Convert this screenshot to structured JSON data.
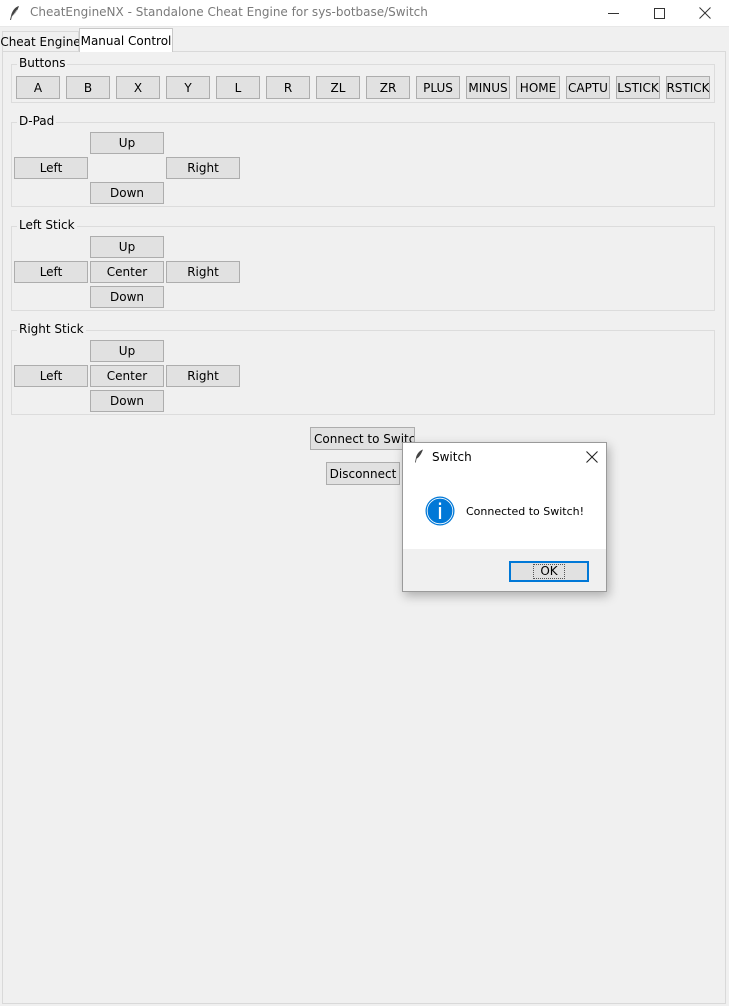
{
  "window": {
    "title": "CheatEngineNX - Standalone Cheat Engine for sys-botbase/Switch",
    "app_icon": "feather-icon",
    "controls": {
      "minimize": "minimize-icon",
      "maximize": "maximize-icon",
      "close": "close-icon"
    }
  },
  "tabs": [
    {
      "label": "Cheat Engine",
      "active": false
    },
    {
      "label": "Manual Control",
      "active": true
    }
  ],
  "buttons_group": {
    "label": "Buttons",
    "items": [
      "A",
      "B",
      "X",
      "Y",
      "L",
      "R",
      "ZL",
      "ZR",
      "PLUS",
      "MINUS",
      "HOME",
      "CAPTU",
      "LSTICK",
      "RSTICK"
    ]
  },
  "dpad": {
    "label": "D-Pad",
    "up": "Up",
    "left": "Left",
    "right": "Right",
    "down": "Down"
  },
  "left_stick": {
    "label": "Left Stick",
    "up": "Up",
    "left": "Left",
    "center": "Center",
    "right": "Right",
    "down": "Down"
  },
  "right_stick": {
    "label": "Right Stick",
    "up": "Up",
    "left": "Left",
    "center": "Center",
    "right": "Right",
    "down": "Down"
  },
  "connection": {
    "connect_label": "Connect to Switch",
    "disconnect_label": "Disconnect"
  },
  "dialog": {
    "title": "Switch",
    "message": "Connected to Switch!",
    "ok_label": "OK",
    "icon": "info-icon",
    "accent_color": "#0078d7"
  }
}
